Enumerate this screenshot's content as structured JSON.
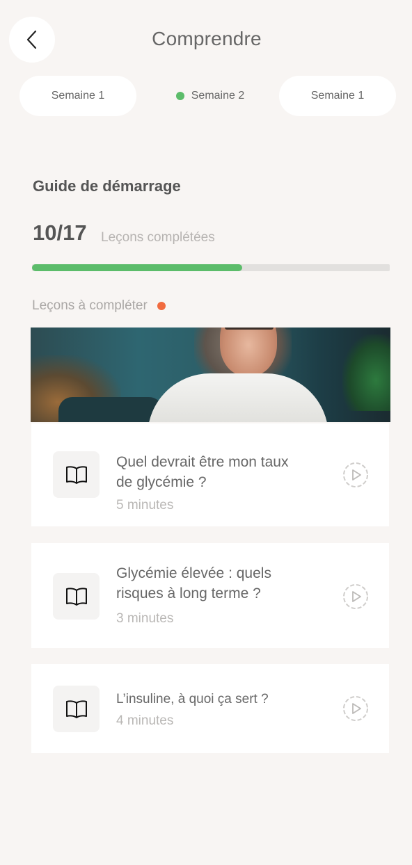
{
  "header": {
    "title": "Comprendre"
  },
  "tabs": [
    {
      "label": "Semaine 1",
      "active": false
    },
    {
      "label": "Semaine 2",
      "active": true
    },
    {
      "label": "Semaine 1",
      "active": false
    }
  ],
  "guide": {
    "title": "Guide de démarrage",
    "progress_count": "10/17",
    "progress_label": "Leçons complétées",
    "completed": 10,
    "total": 17,
    "todo_label": "Leçons à compléter"
  },
  "lessons": [
    {
      "title": "Quel devrait être mon taux de glycémie ?",
      "duration": "5 minutes",
      "icon": "book-icon",
      "action_icon": "play-icon"
    },
    {
      "title": "Glycémie élevée : quels risques à long terme ?",
      "duration": "3 minutes",
      "icon": "book-icon",
      "action_icon": "play-icon"
    },
    {
      "title": "L’insuline, à quoi ça sert ?",
      "duration": "4 minutes",
      "icon": "book-icon",
      "action_icon": "play-icon"
    }
  ],
  "colors": {
    "background": "#f8f5f3",
    "progress": "#5cbc6a",
    "active_dot": "#5cbc6a",
    "todo_dot": "#f16b3f"
  }
}
